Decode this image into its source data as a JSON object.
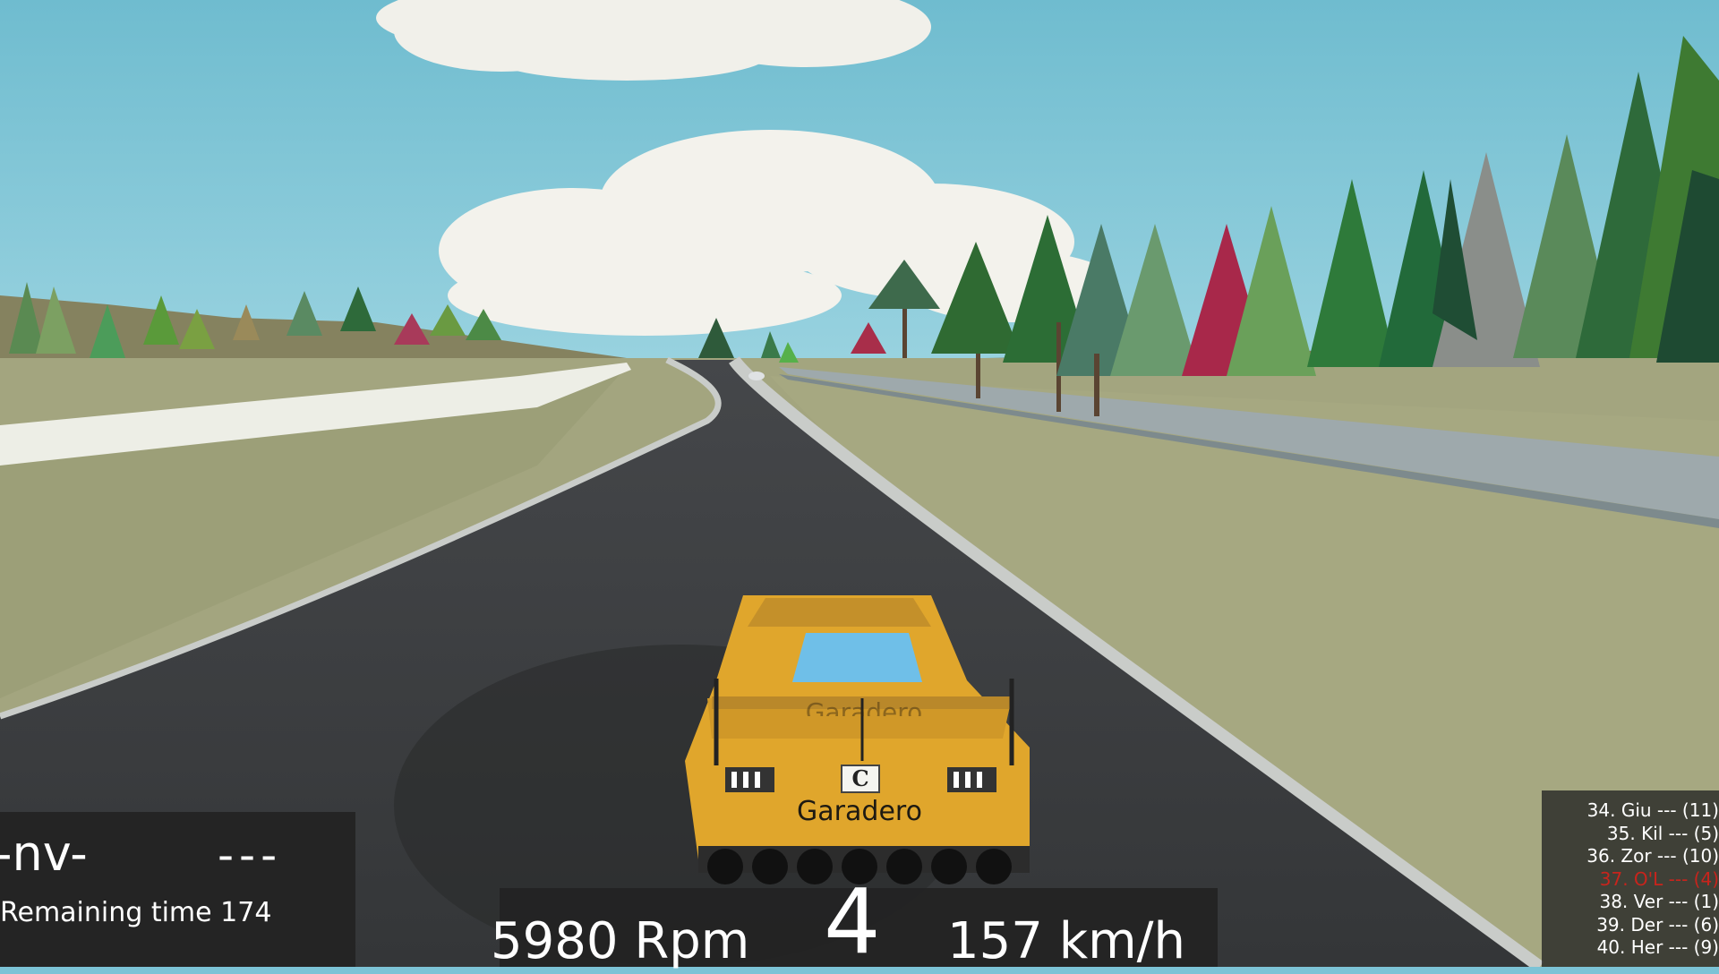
{
  "hud": {
    "player_nick": "-nv-",
    "lap_placeholder": "---",
    "remaining_time": "Remaining time 174",
    "rpm": "5980 Rpm",
    "gear": "4",
    "speed": "157 km/h"
  },
  "car": {
    "sponsor_wing": "Garadero",
    "sponsor_rear": "Garadero",
    "badge": "C",
    "body_color": "#e0a62c"
  },
  "standings": [
    {
      "text": "34. Giu --- (11)",
      "highlight": false
    },
    {
      "text": "35. Kil --- (5)",
      "highlight": false
    },
    {
      "text": "36. Zor --- (10)",
      "highlight": false
    },
    {
      "text": "37. O'L --- (4)",
      "highlight": true
    },
    {
      "text": "38. Ver --- (1)",
      "highlight": false
    },
    {
      "text": "39. Der --- (6)",
      "highlight": false
    },
    {
      "text": "40. Her --- (9)",
      "highlight": false
    }
  ],
  "colors": {
    "sky": "#7cc3d6",
    "grass": "#a3a57f",
    "asphalt": "#3a3c3e",
    "hud_panel": "#232323",
    "highlight": "#c8241c"
  }
}
